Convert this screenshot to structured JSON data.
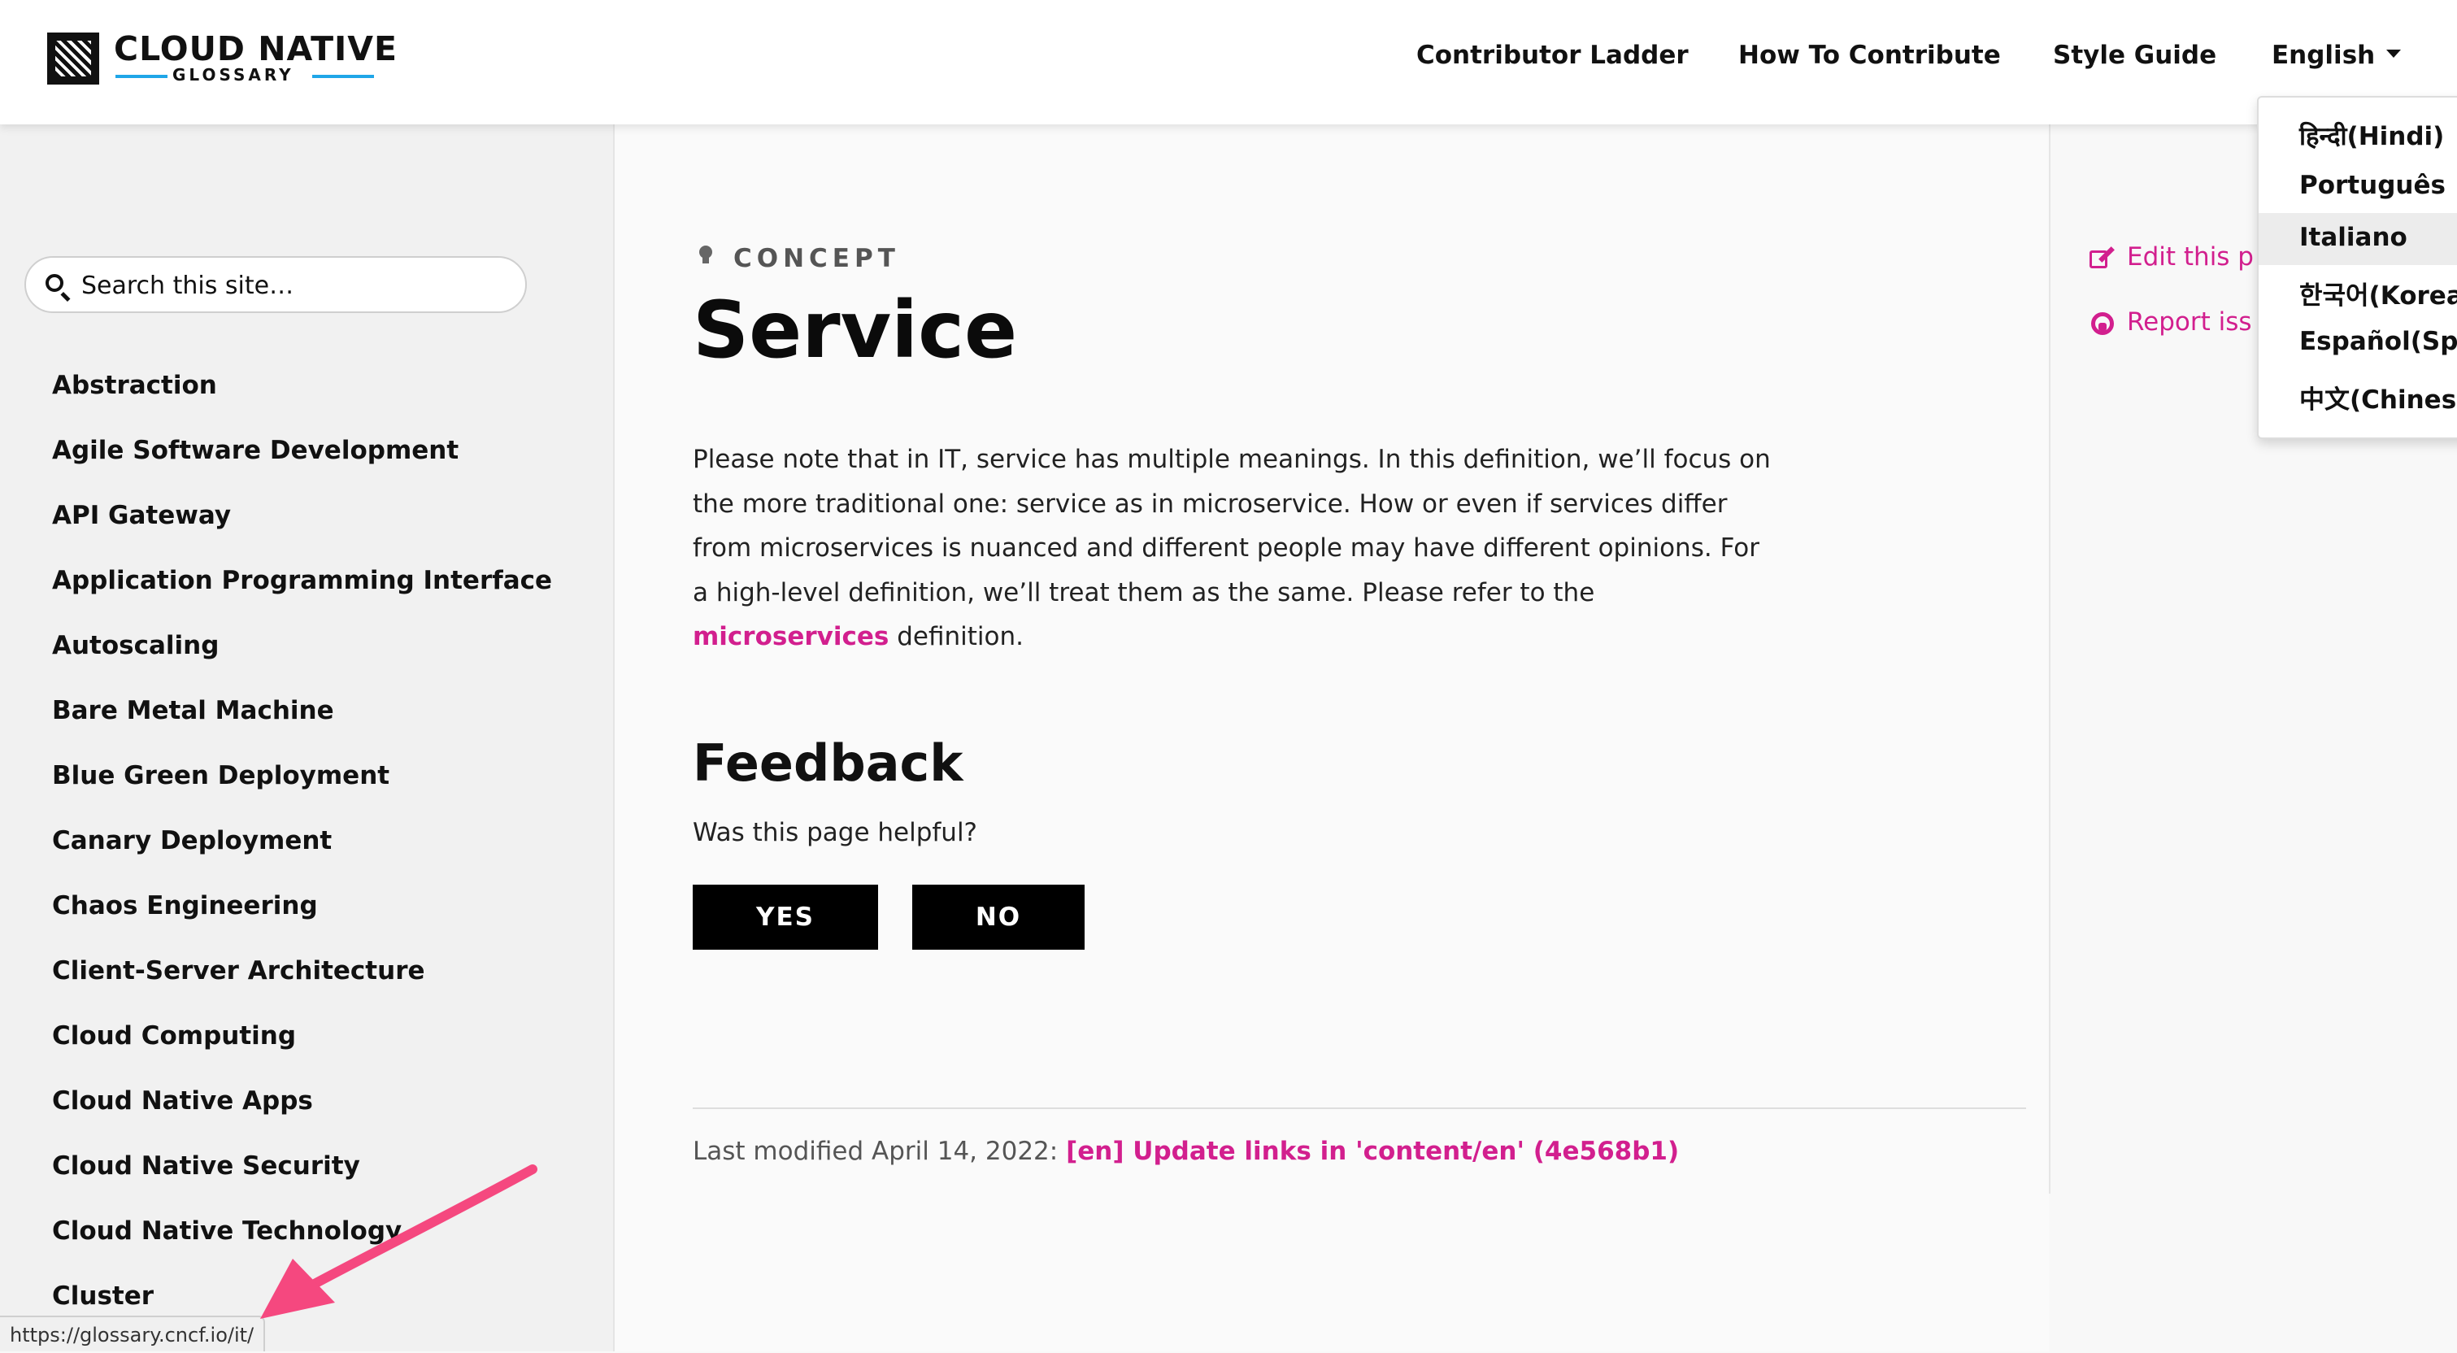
{
  "header": {
    "logo": {
      "title": "CLOUD NATIVE",
      "subtitle": "GLOSSARY"
    },
    "nav": [
      {
        "label": "Contributor Ladder"
      },
      {
        "label": "How To Contribute"
      },
      {
        "label": "Style Guide"
      }
    ],
    "language": {
      "label": "English"
    }
  },
  "language_dropdown": {
    "items": [
      {
        "label": "हिन्दी(Hindi)"
      },
      {
        "label": "Português"
      },
      {
        "label": "Italiano",
        "hovered": true
      },
      {
        "label": "한국어(Korean"
      },
      {
        "label": "Español(Spa"
      },
      {
        "label": "中文(Chinese"
      }
    ]
  },
  "sidebar": {
    "search": {
      "placeholder": "Search this site…"
    },
    "items": [
      {
        "label": "Abstraction"
      },
      {
        "label": "Agile Software Development"
      },
      {
        "label": "API Gateway"
      },
      {
        "label": "Application Programming Interface"
      },
      {
        "label": "Autoscaling"
      },
      {
        "label": "Bare Metal Machine"
      },
      {
        "label": "Blue Green Deployment"
      },
      {
        "label": "Canary Deployment"
      },
      {
        "label": "Chaos Engineering"
      },
      {
        "label": "Client-Server Architecture"
      },
      {
        "label": "Cloud Computing"
      },
      {
        "label": "Cloud Native Apps"
      },
      {
        "label": "Cloud Native Security"
      },
      {
        "label": "Cloud Native Technology"
      },
      {
        "label": "Cluster"
      }
    ]
  },
  "main": {
    "category": "CONCEPT",
    "title": "Service",
    "paragraph": {
      "text": "Please note that in IT, service has multiple meanings. In this definition, we’ll focus on the more traditional one: service as in microservice. How or even if services differ from microservices is nuanced and different people may have different opinions. For a high-level definition, we’ll treat them as the same. Please refer to the ",
      "link": "microservices",
      "after": " definition."
    },
    "feedback": {
      "title": "Feedback",
      "question": "Was this page helpful?",
      "yes": "YES",
      "no": "NO"
    },
    "last_modified": {
      "prefix": "Last modified April 14, 2022: ",
      "link": "[en] Update links in 'content/en' (4e568b1)"
    }
  },
  "right_actions": {
    "edit": "Edit this p",
    "report": "Report iss"
  },
  "status_bar": {
    "url": "https://glossary.cncf.io/it/"
  },
  "colors": {
    "accent": "#d21f8e",
    "arrow": "#f5487f",
    "logo_line": "#1fa6e8"
  }
}
